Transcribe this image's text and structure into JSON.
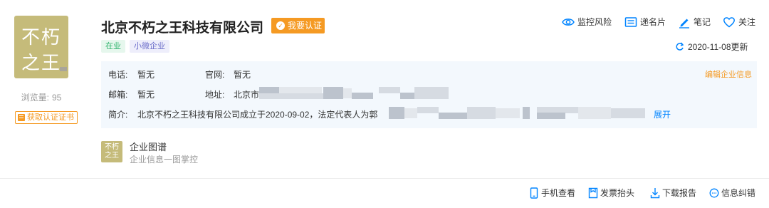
{
  "company": {
    "name": "北京不朽之王科技有限公司",
    "logo_line1": "不朽",
    "logo_line2": "之王",
    "verify_label": "我要认证",
    "tags": [
      "在业",
      "小微企业"
    ]
  },
  "stats": {
    "views_label": "浏览量:",
    "views_count": "95",
    "cert_button": "获取认证证书"
  },
  "actions": {
    "monitor": "监控风险",
    "card": "递名片",
    "note": "笔记",
    "follow": "关注",
    "updated": "2020-11-08更新"
  },
  "info": {
    "phone_label": "电话:",
    "phone_value": "暂无",
    "website_label": "官网:",
    "website_value": "暂无",
    "email_label": "邮箱:",
    "email_value": "暂无",
    "address_label": "地址:",
    "address_value": "北京市",
    "intro_label": "简介:",
    "intro_value": "北京不朽之王科技有限公司成立于2020-09-02，法定代表人为郭",
    "edit_link": "编辑企业信息",
    "expand_link": "展开"
  },
  "graph": {
    "title": "企业图谱",
    "subtitle": "企业信息一图掌控",
    "logo_line1": "不朽",
    "logo_line2": "之王"
  },
  "footer": {
    "mobile": "手机查看",
    "invoice": "发票抬头",
    "download": "下载报告",
    "correct": "信息纠错"
  },
  "colors": {
    "accent_orange": "#f59a23",
    "link_blue": "#0084ff",
    "logo_gold": "#c5bb7a",
    "info_bg": "#f3f8fd"
  }
}
